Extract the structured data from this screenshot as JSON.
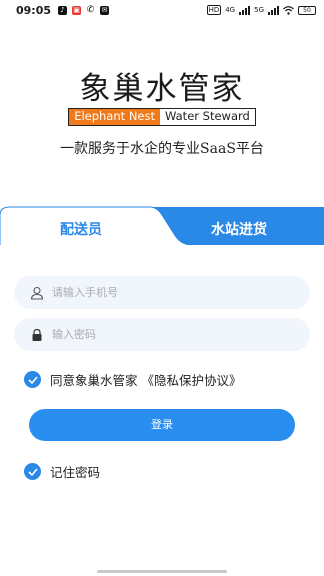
{
  "status_bar": {
    "time": "09:05",
    "net_labels": [
      "HD",
      "4G",
      "5G"
    ],
    "battery": "50"
  },
  "brand": {
    "name_cn": "象巢水管家",
    "name_en_part1": "Elephant Nest",
    "name_en_part2": "Water Steward",
    "tagline": "一款服务于水企的专业SaaS平台",
    "accent_color": "#f07a1a"
  },
  "tabs": [
    {
      "label": "配送员",
      "active": true
    },
    {
      "label": "水站进货",
      "active": false
    }
  ],
  "form": {
    "phone_placeholder": "请输入手机号",
    "password_placeholder": "输入密码",
    "agree_label": "同意象巢水管家 《隐私保护协议》",
    "login_label": "登录",
    "remember_label": "记住密码",
    "agree_checked": true,
    "remember_checked": true
  },
  "colors": {
    "primary": "#2a88e6"
  }
}
